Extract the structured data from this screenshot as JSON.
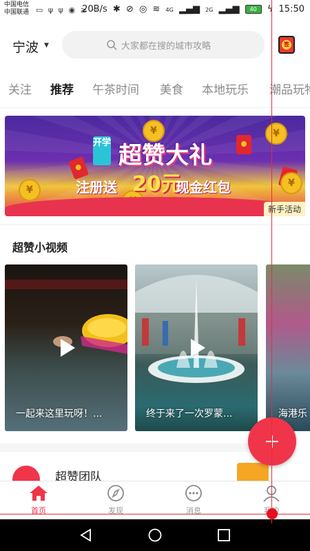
{
  "status_bar": {
    "carrier_1": "中国电信",
    "carrier_2": "中国联通",
    "network_speed": "20B/s",
    "signal_1": "4G",
    "signal_2": "2G",
    "battery": "40",
    "time": "15:50",
    "more": "···"
  },
  "header": {
    "city": "宁波",
    "search_placeholder": "大家都在搜的城市攻略",
    "checkin_icon": "checkin-icon",
    "checkin_label": "签"
  },
  "tabs": [
    {
      "label": "关注",
      "active": false
    },
    {
      "label": "推荐",
      "active": true
    },
    {
      "label": "午茶时间",
      "active": false
    },
    {
      "label": "美食",
      "active": false
    },
    {
      "label": "本地玩乐",
      "active": false
    },
    {
      "label": "潮品玩物",
      "active": false
    }
  ],
  "banner": {
    "tag": "开学",
    "title": "超赞大礼",
    "sub_1": "注册送",
    "amount": "20元",
    "sub_2": "现金红包",
    "badge": "新手活动",
    "coin_symbol": "¥"
  },
  "videos_section": {
    "title": "超赞小视频",
    "items": [
      {
        "caption": "一起来这里玩呀！..."
      },
      {
        "caption": "终于来了一次罗蒙..."
      },
      {
        "caption": "海港乐"
      }
    ]
  },
  "team": {
    "name": "超赞团队"
  },
  "bottom_nav": [
    {
      "label": "首页",
      "icon": "home-icon",
      "active": true
    },
    {
      "label": "发现",
      "icon": "compass-icon",
      "active": false
    },
    {
      "label": "消息",
      "icon": "chat-icon",
      "active": false
    },
    {
      "label": "我的",
      "icon": "user-icon",
      "active": false
    }
  ],
  "colors": {
    "accent": "#f0354a",
    "text_primary": "#222222",
    "text_secondary": "#999999"
  }
}
